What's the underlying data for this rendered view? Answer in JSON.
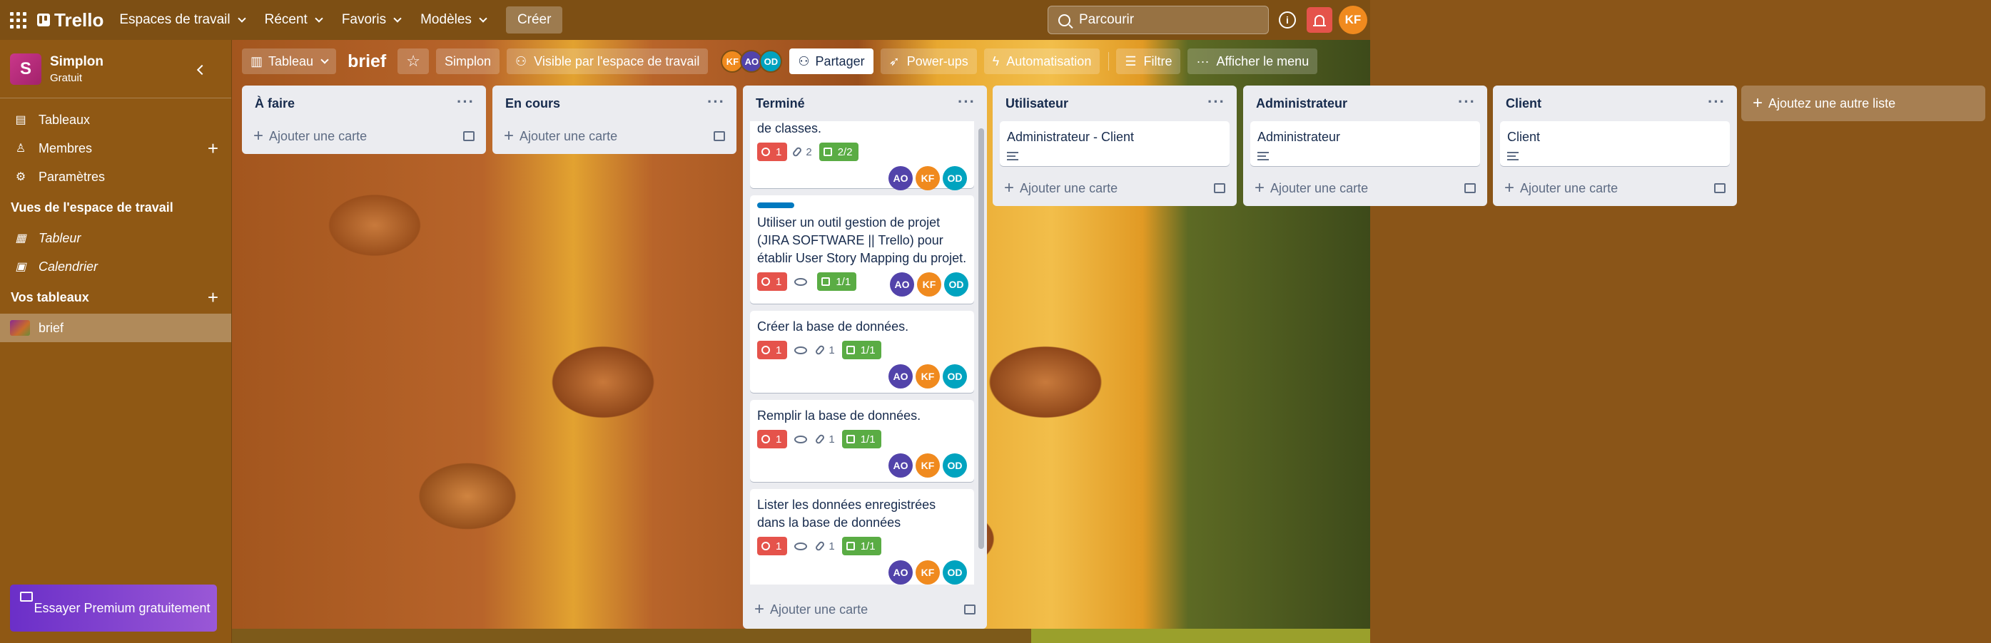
{
  "header": {
    "logo": "Trello",
    "nav": [
      "Espaces de travail",
      "Récent",
      "Favoris",
      "Modèles"
    ],
    "create": "Créer",
    "search_placeholder": "Parcourir",
    "user_initials": "KF",
    "info": "i"
  },
  "sidebar": {
    "workspace_initial": "S",
    "workspace_name": "Simplon",
    "workspace_plan": "Gratuit",
    "items": [
      {
        "label": "Tableaux",
        "icon": "board-icon"
      },
      {
        "label": "Membres",
        "icon": "member-icon"
      },
      {
        "label": "Paramètres",
        "icon": "gear-icon"
      }
    ],
    "views_heading": "Vues de l'espace de travail",
    "views": [
      {
        "label": "Tableur",
        "icon": "table-icon"
      },
      {
        "label": "Calendrier",
        "icon": "calendar-icon"
      }
    ],
    "boards_heading": "Vos tableaux",
    "boards": [
      "brief"
    ],
    "premium": "Essayer Premium gratuitement"
  },
  "board": {
    "view": "Tableau",
    "title": "brief",
    "workspace": "Simplon",
    "visibility": "Visible par l'espace de travail",
    "members": [
      {
        "initials": "KF",
        "color": "#f08a1e"
      },
      {
        "initials": "AO",
        "color": "#5243aa"
      },
      {
        "initials": "OD",
        "color": "#00a3bf"
      }
    ],
    "share": "Partager",
    "powerups": "Power-ups",
    "automation": "Automatisation",
    "filter": "Filtre",
    "menu": "Afficher le menu"
  },
  "lists": [
    {
      "title": "À faire",
      "add": "Ajouter une carte"
    },
    {
      "title": "En cours",
      "add": "Ajouter une carte"
    },
    {
      "title": "Terminé",
      "add": "Ajouter une carte",
      "cards": [
        {
          "title": "de classes.",
          "due": "1",
          "attachments": "2",
          "checklist": "2/2",
          "watch": false
        },
        {
          "title": "Utiliser un outil gestion de projet (JIRA SOFTWARE || Trello) pour établir User Story Mapping du projet.",
          "due": "1",
          "checklist": "1/1",
          "watch": true
        },
        {
          "title": "Créer la base de données.",
          "due": "1",
          "attachments": "1",
          "checklist": "1/1",
          "watch": true
        },
        {
          "title": "Remplir la base de données.",
          "due": "1",
          "attachments": "1",
          "checklist": "1/1",
          "watch": true
        },
        {
          "title": "Lister les données enregistrées dans la base de données",
          "due": "1",
          "attachments": "1",
          "checklist": "1/1",
          "watch": true
        }
      ],
      "card_members": [
        "AO",
        "KF",
        "OD"
      ]
    },
    {
      "title": "Utilisateur",
      "add": "Ajouter une carte",
      "cards": [
        {
          "title": "Administrateur - Client"
        }
      ]
    },
    {
      "title": "Administrateur",
      "add": "Ajouter une carte",
      "cards": [
        {
          "title": "Administrateur"
        }
      ]
    },
    {
      "title": "Client",
      "add": "Ajouter une carte",
      "cards": [
        {
          "title": "Client"
        }
      ]
    }
  ],
  "add_list": "Ajoutez une autre liste",
  "colors": {
    "ao": "#5243aa",
    "kf": "#f08a1e",
    "od": "#00a3bf",
    "due_red": "#e5534b",
    "check_green": "#5aac44",
    "label_blue": "#0079bf"
  }
}
